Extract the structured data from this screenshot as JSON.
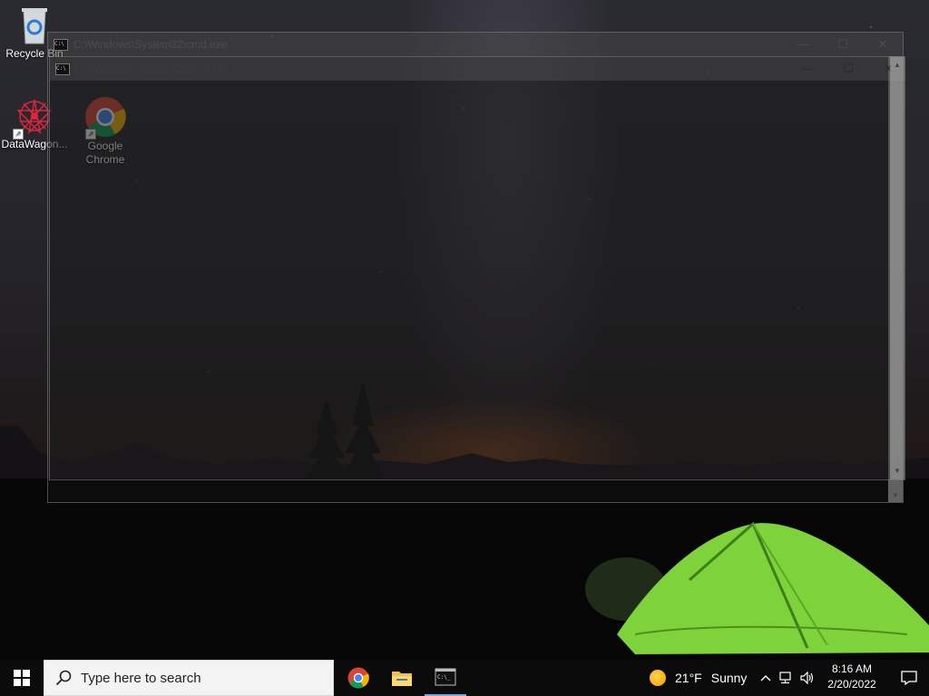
{
  "desktop": {
    "icons": [
      {
        "label": "Recycle Bin",
        "icon": "recycle-bin-icon"
      },
      {
        "label": "DataWagon...",
        "icon": "datawagon-icon"
      },
      {
        "label": "Google Chrome",
        "icon": "chrome-icon"
      }
    ]
  },
  "windows": [
    {
      "title": "C:\\Windows\\System32\\cmd.exe",
      "icon": "cmd-icon"
    },
    {
      "title": "C:\\Windows\\System32\\cmd.exe",
      "icon": "cmd-icon"
    }
  ],
  "window_controls": {
    "minimize": "—",
    "maximize": "☐",
    "close": "✕"
  },
  "taskbar": {
    "search_placeholder": "Type here to search",
    "pinned_apps": [
      "chrome-icon",
      "file-explorer-icon",
      "cmd-icon"
    ],
    "weather": {
      "temp": "21°F",
      "condition": "Sunny"
    },
    "clock": {
      "time": "8:16 AM",
      "date": "2/20/2022"
    },
    "tray_icons": [
      "chevron-up-icon",
      "network-icon",
      "volume-icon"
    ]
  }
}
